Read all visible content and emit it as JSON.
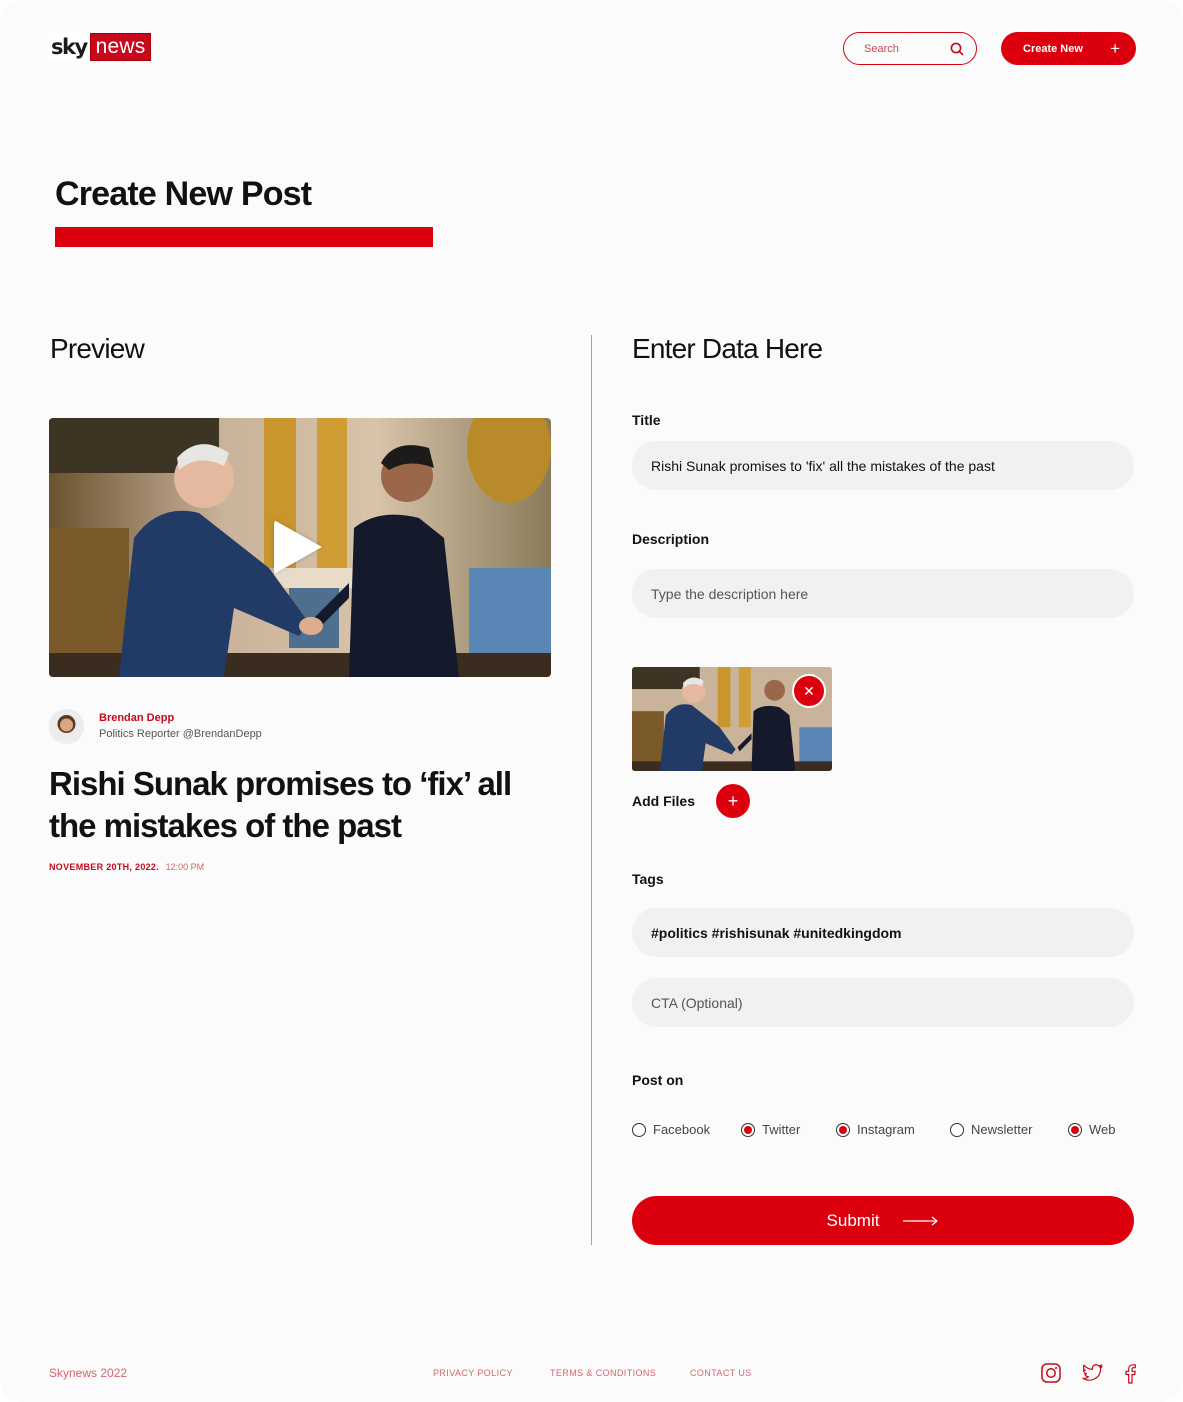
{
  "header": {
    "logo": {
      "sky": "sky",
      "news": "news"
    },
    "search": {
      "placeholder": "Search",
      "icon": "search-icon"
    },
    "create_button": {
      "label": "Create New",
      "icon": "plus-icon"
    }
  },
  "page_title": "Create New Post",
  "preview": {
    "heading": "Preview",
    "media": {
      "type": "video",
      "icon": "play-icon"
    },
    "author": {
      "name": "Brendan Depp",
      "role": "Politics Reporter @BrendanDepp"
    },
    "headline": "Rishi Sunak promises to ‘fix’ all the mistakes of the past",
    "date": "NOVEMBER 20TH, 2022.",
    "time": "12:00 PM"
  },
  "form": {
    "heading": "Enter Data Here",
    "title": {
      "label": "Title",
      "value": "Rishi Sunak promises to 'fix' all the mistakes of the past"
    },
    "description": {
      "label": "Description",
      "value": "",
      "placeholder": "Type the description here"
    },
    "attachments": {
      "remove_icon": "close-icon",
      "add_label": "Add Files",
      "add_icon": "plus-icon"
    },
    "tags": {
      "label": "Tags",
      "value": "#politics #rishisunak #unitedkingdom"
    },
    "cta": {
      "value": "",
      "placeholder": "CTA (Optional)"
    },
    "post_on": {
      "label": "Post on",
      "options": [
        {
          "label": "Facebook",
          "checked": false
        },
        {
          "label": "Twitter",
          "checked": true
        },
        {
          "label": "Instagram",
          "checked": true
        },
        {
          "label": "Newsletter",
          "checked": false
        },
        {
          "label": "Web",
          "checked": true
        }
      ]
    },
    "submit_label": "Submit"
  },
  "footer": {
    "copyright": "Skynews 2022",
    "links": [
      "PRIVACY POLICY",
      "TERMS & CONDITIONS",
      "CONTACT US"
    ],
    "social": [
      "instagram-icon",
      "twitter-icon",
      "facebook-icon"
    ]
  },
  "colors": {
    "brand_red": "#dc000f",
    "footer_text": "#d46670",
    "field_bg": "#f1f1f1",
    "page_bg": "#fbfbfb"
  }
}
